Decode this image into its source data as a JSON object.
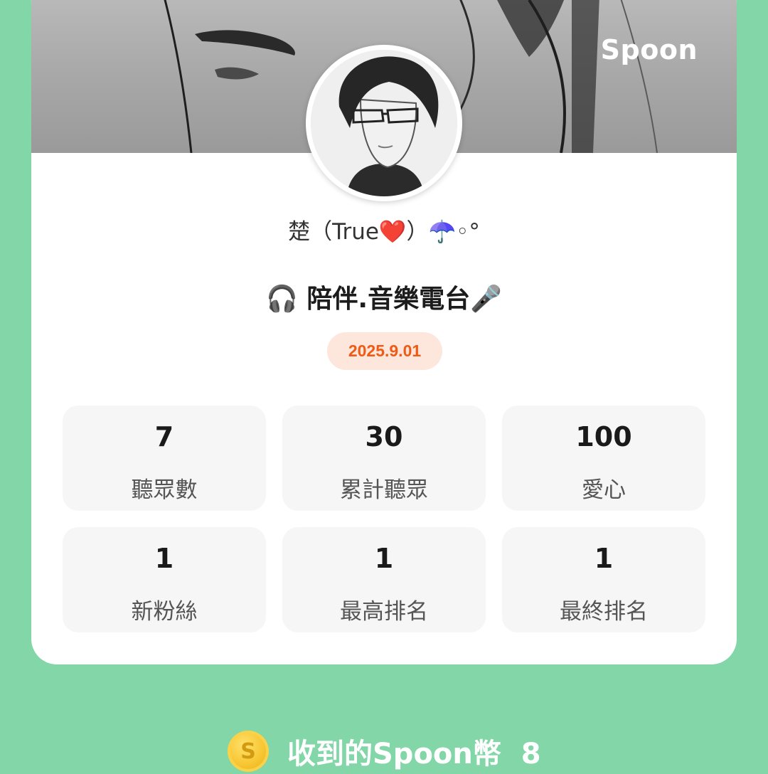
{
  "brand": "Spoon",
  "profile": {
    "nickname": "楚（True❤️）☂️◦°",
    "title": "🎧 陪伴.音樂電台🎤",
    "date": "2025.9.01"
  },
  "stats": [
    {
      "value": "7",
      "label": "聽眾數"
    },
    {
      "value": "30",
      "label": "累計聽眾"
    },
    {
      "value": "100",
      "label": "愛心"
    },
    {
      "value": "1",
      "label": "新粉絲"
    },
    {
      "value": "1",
      "label": "最高排名"
    },
    {
      "value": "1",
      "label": "最終排名"
    }
  ],
  "coins": {
    "icon_letter": "S",
    "text": "收到的Spoon幣  8"
  },
  "colors": {
    "background": "#82d6a8",
    "date_text": "#f05a14",
    "date_badge": "#fde6dc",
    "coin": "#f7c531"
  },
  "icons": [
    "headphones-icon",
    "microphone-icon",
    "heart-icon",
    "umbrella-icon",
    "spoon-coin-icon"
  ]
}
